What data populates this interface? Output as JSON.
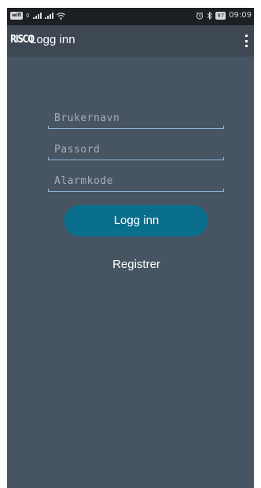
{
  "statusbar": {
    "carrier_badge": "wifi",
    "network_left": "0",
    "signal_label": ".ıl .ıl",
    "wifi_icon": "wifi-icon",
    "alarm_icon": "alarm-clock-icon",
    "bluetooth_icon": "bluetooth-icon",
    "battery": "97",
    "time": "09:09"
  },
  "appbar": {
    "logo_text": "RISCO",
    "title": "Logg inn",
    "menu_icon": "overflow-menu-icon"
  },
  "form": {
    "username": {
      "value": "",
      "placeholder": "Brukernavn"
    },
    "password": {
      "value": "",
      "placeholder": "Passord"
    },
    "alarmcode": {
      "value": "",
      "placeholder": "Alarmkode"
    },
    "login_label": "Logg inn",
    "register_label": "Registrer"
  },
  "colors": {
    "background": "#475563",
    "appbar": "#3d4853",
    "statusbar": "#1c1f23",
    "accent_button": "#0a6f8d",
    "field_underline": "#8fb8d8"
  }
}
